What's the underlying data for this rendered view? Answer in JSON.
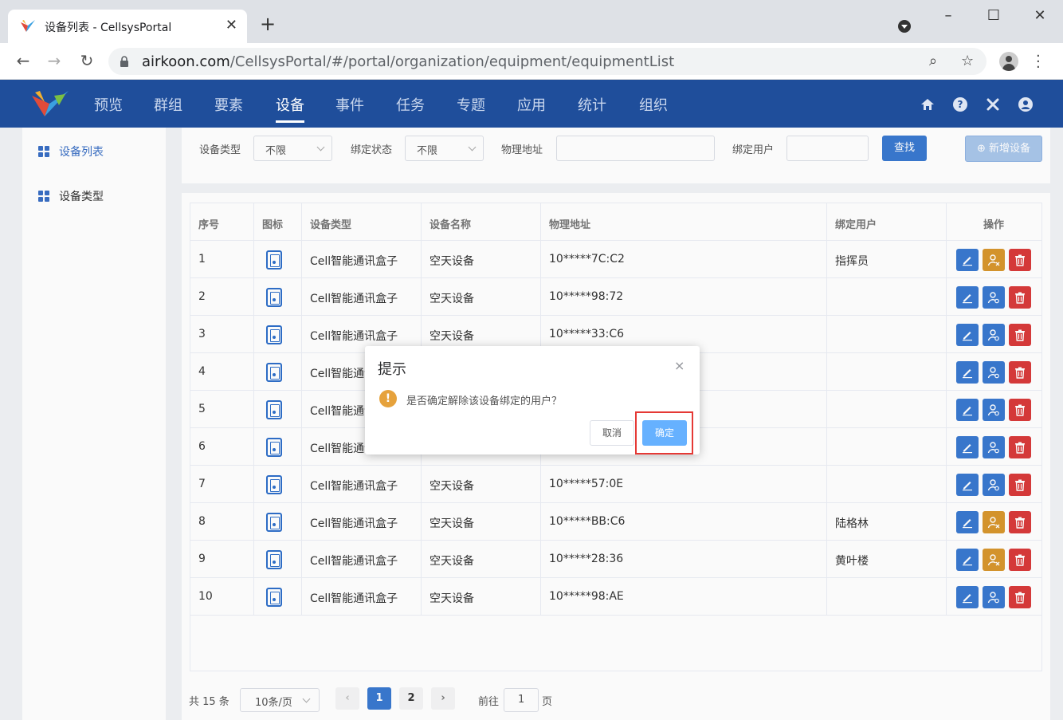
{
  "browser": {
    "tab_title": "设备列表 - CellsysPortal",
    "tab_close": "✕",
    "new_tab": "+",
    "url_host": "airkoon.com",
    "url_path": "/CellsysPortal/#/portal/organization/equipment/equipmentList",
    "win_minimize": "–",
    "win_maximize": "☐",
    "win_close": "✕"
  },
  "app": {
    "menu": [
      "预览",
      "群组",
      "要素",
      "设备",
      "事件",
      "任务",
      "专题",
      "应用",
      "统计",
      "组织"
    ],
    "active_menu": "设备"
  },
  "sidebar": {
    "items": [
      {
        "label": "设备列表",
        "active": true
      },
      {
        "label": "设备类型",
        "active": false
      }
    ]
  },
  "filters": {
    "type_label": "设备类型",
    "type_value": "不限",
    "bind_label": "绑定状态",
    "bind_value": "不限",
    "mac_label": "物理地址",
    "mac_value": "",
    "user_label": "绑定用户",
    "user_value": "",
    "search_button": "查找",
    "add_button": "⊕ 新增设备"
  },
  "table": {
    "columns": [
      "序号",
      "图标",
      "设备类型",
      "设备名称",
      "物理地址",
      "绑定用户",
      "操作"
    ],
    "rows": [
      {
        "no": "1",
        "type": "Cell智能通讯盒子",
        "name": "空天设备",
        "mac": "10*****7C:C2",
        "user": "指挥员",
        "bound": true
      },
      {
        "no": "2",
        "type": "Cell智能通讯盒子",
        "name": "空天设备",
        "mac": "10*****98:72",
        "user": "",
        "bound": false
      },
      {
        "no": "3",
        "type": "Cell智能通讯盒子",
        "name": "空天设备",
        "mac": "10*****33:C6",
        "user": "",
        "bound": false
      },
      {
        "no": "4",
        "type": "Cell智能通讯盒子",
        "name": "",
        "mac": "",
        "user": "",
        "bound": false
      },
      {
        "no": "5",
        "type": "Cell智能通讯盒子",
        "name": "",
        "mac": "",
        "user": "",
        "bound": false
      },
      {
        "no": "6",
        "type": "Cell智能通讯盒子",
        "name": "",
        "mac": "",
        "user": "",
        "bound": false
      },
      {
        "no": "7",
        "type": "Cell智能通讯盒子",
        "name": "空天设备",
        "mac": "10*****57:0E",
        "user": "",
        "bound": false
      },
      {
        "no": "8",
        "type": "Cell智能通讯盒子",
        "name": "空天设备",
        "mac": "10*****BB:C6",
        "user": "陆格林",
        "bound": true
      },
      {
        "no": "9",
        "type": "Cell智能通讯盒子",
        "name": "空天设备",
        "mac": "10*****28:36",
        "user": "黄叶楼",
        "bound": true
      },
      {
        "no": "10",
        "type": "Cell智能通讯盒子",
        "name": "空天设备",
        "mac": "10*****98:AE",
        "user": "",
        "bound": false
      }
    ]
  },
  "pagination": {
    "total": "共 15 条",
    "page_size": "10条/页",
    "prev": "‹",
    "next": "›",
    "pages": [
      "1",
      "2"
    ],
    "current": "1",
    "goto_prefix": "前往",
    "goto_value": "1",
    "goto_suffix": "页"
  },
  "dialog": {
    "title": "提示",
    "close": "×",
    "warn_symbol": "!",
    "message": "是否确定解除该设备绑定的用户？",
    "cancel": "取消",
    "confirm": "确定"
  },
  "colors": {
    "header": "#1f4e9b",
    "primary": "#3a79d0",
    "unbind": "#d8962d",
    "delete": "#d93b3b",
    "highlight": "#e53935"
  }
}
